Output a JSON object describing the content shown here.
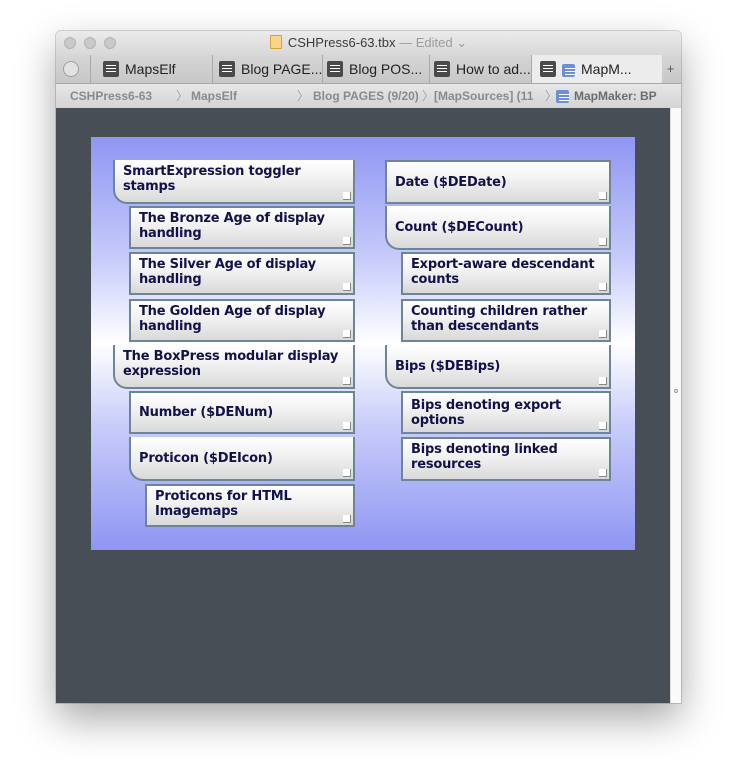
{
  "window": {
    "title": "CSHPress6-63.tbx",
    "title_suffix": "— Edited",
    "title_chevron": "⌄"
  },
  "tabs": [
    {
      "label": "MapsElf"
    },
    {
      "label": "Blog PAGE..."
    },
    {
      "label": "Blog POS..."
    },
    {
      "label": "How to ad..."
    },
    {
      "label": "MapM..."
    }
  ],
  "new_tab_label": "+",
  "breadcrumbs": [
    "CSHPress6-63",
    "MapsElf",
    "Blog PAGES (9/20)",
    "[MapSources] (11",
    "MapMaker: BP"
  ],
  "map": {
    "left_column": [
      {
        "label": "SmartExpression toggler stamps"
      },
      {
        "label": "The Bronze Age of display handling"
      },
      {
        "label": "The Silver Age of display handling"
      },
      {
        "label": "The Golden Age of display handling"
      },
      {
        "label": "The BoxPress modular display expression"
      },
      {
        "label": "Number ($DENum)"
      },
      {
        "label": "Proticon ($DEIcon)"
      },
      {
        "label": "Proticons for HTML Imagemaps"
      }
    ],
    "right_column": [
      {
        "label": "Date ($DEDate)"
      },
      {
        "label": "Count ($DECount)"
      },
      {
        "label": "Export-aware descendant counts"
      },
      {
        "label": "Counting children rather than descendants"
      },
      {
        "label": "Bips ($DEBips)"
      },
      {
        "label": "Bips denoting export options"
      },
      {
        "label": "Bips denoting linked resources"
      }
    ]
  }
}
